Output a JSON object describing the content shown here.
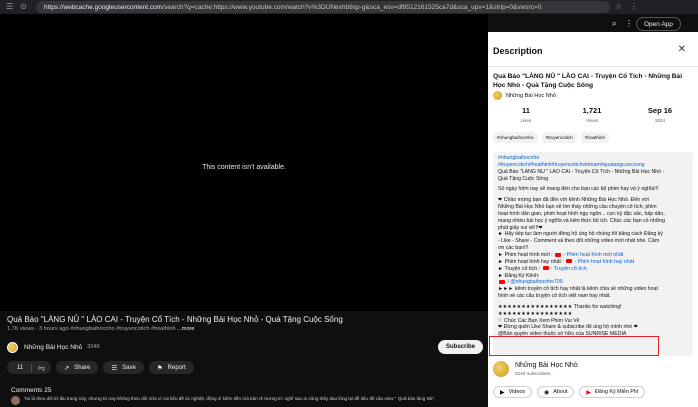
{
  "browser": {
    "url_host": "https://webcache.googleusercontent.com",
    "url_rest": "/search?q=cache:https://www.youtube.com/watch?v%3DUNexhb9sp-g&sca_esv=df9512161525ca7d&sca_upv=1&strip=0&vwsrc=0",
    "open_app_label": "Open App"
  },
  "player": {
    "message": "This content isn't available."
  },
  "video": {
    "title": "Quả Báo \"LÀNG NỦ \" LÀO CAI - Truyện Cổ Tích - Những Bài Học Nhỏ - Quà Tặng Cuộc Sống",
    "meta": "1.7K views · 3 hours ago #nhungbaihocnho #truyencotich #hoathinh",
    "more_label": "...more"
  },
  "channel": {
    "name": "Những Bài Học Nhỏ",
    "subs": "324K",
    "subscribe_label": "Subscribe"
  },
  "actions": {
    "like_count": "11",
    "share_label": "Share",
    "save_label": "Save",
    "report_label": "Report"
  },
  "comments": {
    "title": "Comments 25",
    "first_comment": "Tui là theo dõi từ lâu trang này, nhưng từ nay không theo dõi nữa vì cái tiêu đề ác nghiệt, động vì kiếm tiền mà bản rẻ tương tri: nghĩ sao ai cũng thấy đau lòng lại đề tiêu đề câu view \" Quả báo làng Nủ\","
  },
  "description": {
    "header": "Description",
    "title": "Quả Báo \"LÀNG NỦ \" LÀO CAI - Truyện Cổ Tích - Những Bài Học Nhỏ - Quà Tặng Cuộc Sống",
    "channel_name": "Những Bài Học Nhỏ",
    "stats": {
      "likes_num": "11",
      "likes_label": "Likes",
      "views_num": "1,721",
      "views_label": "Views",
      "date_num": "Sep 16",
      "date_label": "2024"
    },
    "tags": [
      "#nhungbaihocnho",
      "#truyencotich",
      "#hoathinh"
    ],
    "body": {
      "hashtag1": "#nhungbaihocnho",
      "hashtag2": "#truyencotich#hoathinh#truyencotichvietnam#quatangcuocsong",
      "title_line1": "Quả Báo \"LÀNG NỦ \" LÀO CAI - Truyện Cổ Tích - Những Bài Học Nhỏ -",
      "title_line2": "Quà Tặng Cuộc Sống",
      "intro": "Số ngày hôm nay sẽ mang đến cho bạn các bộ phim hay và ý nghĩa!!!",
      "p1": "❤ Chào mừng bạn đã đến với kênh Những Bài Học Nhỏ. Đến với",
      "p2": "Những Bài Học Nhỏ bạn sẽ tìm thấy những câu chuyện cổ tích, phim",
      "p3": "hoạt hình dân gian, phim hoạt hình ngụ ngôn... cực kỳ đặc sắc, hấp dẫn,",
      "p4": "mang nhiều bài học ý nghĩa và kiến thức bổ ích. Chúc các bạn có những",
      "p5": "phút giây vui vẻ!!!❤",
      "p6": "► Hãy tiếp tục làm người đồng hộ ủng hộ chúng tôi bằng cách Đăng ký",
      "p7": "- Like - Share - Comment và theo dõi những video mới nhất nhé. Cảm",
      "p8": "ơn các bạn!!!",
      "p9a": "► Phim hoạt hình mới :",
      "p9b": "- Phim hoạt hình mới nhất",
      "p10a": "► Phim hoạt hình hay nhất :",
      "p10b": "- Phim hoạt hình hay nhất",
      "p11a": "► Truyện cổ tích :",
      "p11b": "- Truyện cổ tích",
      "p12": "► Đăng Ký Kênh:",
      "p13": "/ @nhungbaihocnho709",
      "p14": "►►► kênh truyện cổ tích hay nhất là kênh chia sẻ những video hoạt",
      "p15": "hình về các câu truyện cổ tích việt nam hay nhất.",
      "p16": "★★★★★★★★★★★★★★★★ Thanks for watching!",
      "p17": "★★★★★★★★★★★★★★★★",
      "p18": "♡ Chúc Các Bạn Xem Phim Vui Vẻ",
      "p19": "❤ Đừng quên Like Share & subscribe để ủng hộ mình nhé ❤",
      "p20": "@Bản quyền video thuộc sở hữu của SUNRISE MEDIA"
    },
    "channel_card": {
      "name": "Những Bài Học Nhỏ",
      "subs": "324K subscribers"
    },
    "buttons": {
      "videos": "Videos",
      "about": "About",
      "free_skill": "Đăng Ký Miễn Phí"
    }
  }
}
